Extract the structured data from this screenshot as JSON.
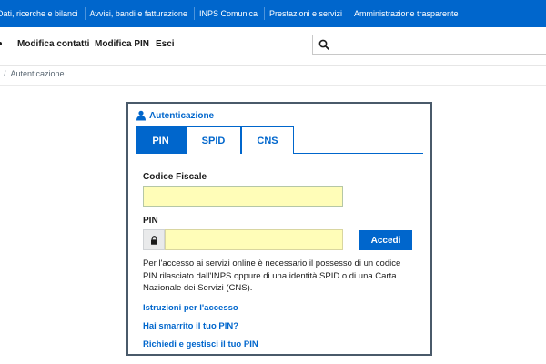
{
  "topnav": {
    "items": [
      "Dati, ricerche e bilanci",
      "Avvisi, bandi e fatturazione",
      "INPS Comunica",
      "Prestazioni e servizi",
      "Amministrazione trasparente"
    ]
  },
  "secbar": {
    "links": [
      "Modifica contatti",
      "Modifica PIN",
      "Esci"
    ]
  },
  "breadcrumb": {
    "items": [
      "l",
      "Autenticazione"
    ]
  },
  "panel": {
    "title": "Autenticazione",
    "tabs": [
      "PIN",
      "SPID",
      "CNS"
    ],
    "fields": {
      "codice_fiscale_label": "Codice Fiscale",
      "codice_fiscale_value": "",
      "pin_label": "PIN",
      "pin_value": ""
    },
    "submit_label": "Accedi",
    "info_text": "Per l'accesso ai servizi online è necessario il possesso di un codice PIN rilasciato dall'INPS oppure di una identità SPID o di una Carta Nazionale dei Servizi (CNS).",
    "links": [
      "Istruzioni per l'accesso",
      "Hai smarrito il tuo PIN?",
      "Richiedi e gestisci il tuo PIN"
    ]
  },
  "colors": {
    "brand_blue": "#0066cc",
    "input_highlight": "#fffdb8",
    "panel_border": "#4a5a6a"
  },
  "icons": {
    "search": "search-icon",
    "user": "user-icon",
    "lock": "lock-icon"
  }
}
